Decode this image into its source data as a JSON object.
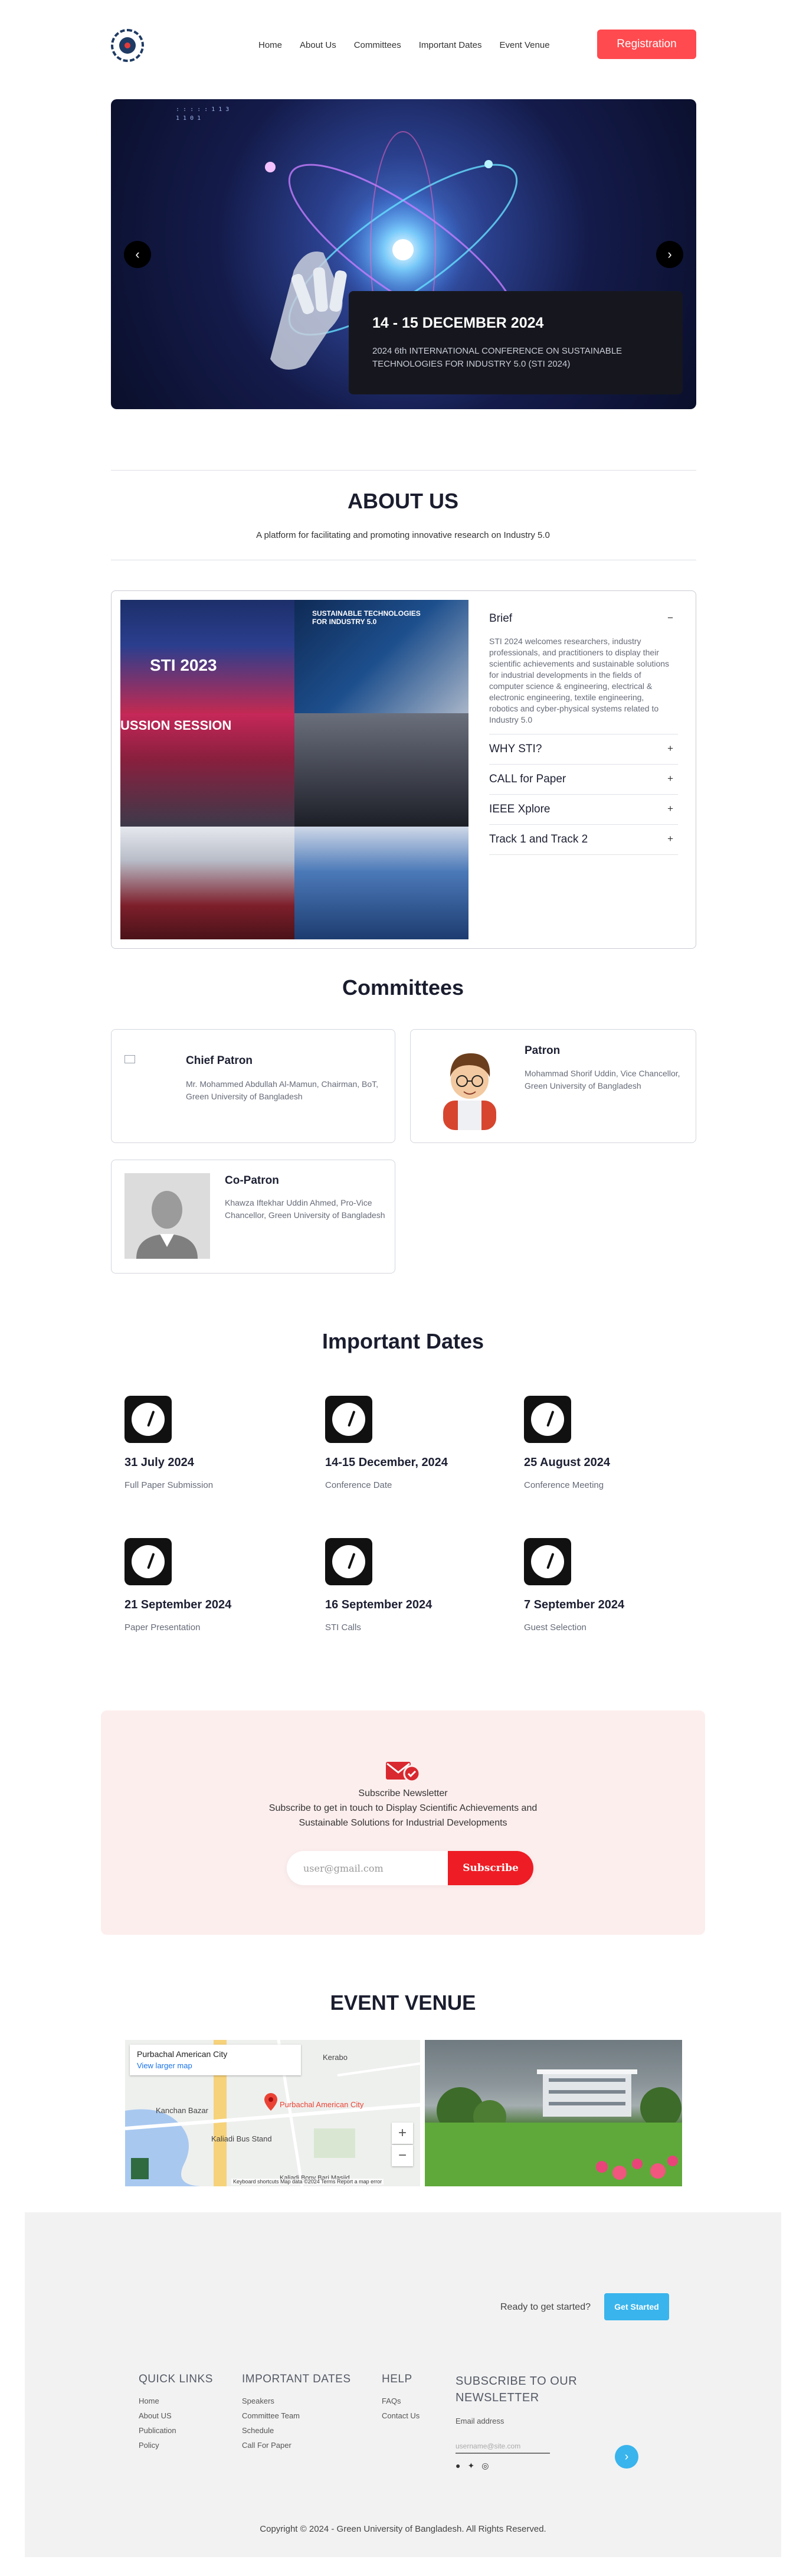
{
  "header": {
    "nav": [
      "Home",
      "About Us",
      "Committees",
      "Important Dates",
      "Event Venue"
    ],
    "register_label": "Registration"
  },
  "hero": {
    "date": "14 - 15 DECEMBER 2024",
    "description": "2024 6th INTERNATIONAL CONFERENCE ON SUSTAINABLE TECHNOLOGIES FOR INDUSTRY 5.0 (STI 2024)",
    "prev_icon": "chevron-left-icon",
    "next_icon": "chevron-right-icon"
  },
  "about": {
    "title": "ABOUT US",
    "subtitle": "A platform for facilitating and promoting innovative research on Industry 5.0",
    "collage_banner_1": "SUSTAINABLE TECHNOLOGIES FOR INDUSTRY 5.0",
    "collage_banner_2": "STI 2023",
    "collage_banner_3": "USSION SESSION",
    "accordion": [
      {
        "title": "Brief",
        "sign": "−",
        "body": "STI 2024 welcomes researchers, industry professionals, and practitioners to display their scientific achievements and sustainable solutions for industrial developments in the fields of computer science & engineering, electrical & electronic engineering, textile engineering, robotics and cyber-physical systems related to Industry 5.0"
      },
      {
        "title": "WHY STI?",
        "sign": "+"
      },
      {
        "title": "CALL for Paper",
        "sign": "+"
      },
      {
        "title": "IEEE Xplore",
        "sign": "+"
      },
      {
        "title": "Track 1 and Track 2",
        "sign": "+"
      }
    ]
  },
  "committees": {
    "title": "Committees",
    "members": [
      {
        "role": "Chief Patron",
        "person": "Mr. Mohammed Abdullah Al-Mamun, Chairman, BoT, Green University of Bangladesh"
      },
      {
        "role": "Patron",
        "person": "Mohammad Shorif Uddin, Vice Chancellor, Green University of Bangladesh"
      },
      {
        "role": "Co-Patron",
        "person": "Khawza Iftekhar Uddin Ahmed, Pro-Vice Chancellor, Green University of Bangladesh"
      }
    ]
  },
  "dates": {
    "title": "Important Dates",
    "items": [
      {
        "date": "31 July 2024",
        "label": "Full Paper Submission"
      },
      {
        "date": "14-15 December, 2024",
        "label": "Conference Date"
      },
      {
        "date": "25 August 2024",
        "label": "Conference Meeting"
      },
      {
        "date": "21 September 2024",
        "label": "Paper Presentation"
      },
      {
        "date": "16 September 2024",
        "label": "STI Calls"
      },
      {
        "date": "7 September 2024",
        "label": "Guest Selection"
      }
    ]
  },
  "newsletter": {
    "title": "Subscribe Newsletter",
    "subtitle": "Subscribe to get in touch to Display Scientific Achievements and Sustainable Solutions for Industrial Developments",
    "placeholder": "user@gmail.com",
    "button": "Subscribe"
  },
  "venue": {
    "title": "EVENT VENUE",
    "map_place": "Purbachal American City",
    "map_link": "View larger map",
    "map_labels": {
      "kerabo": "Kerabo",
      "bazar": "Kanchan Bazar",
      "pin": "Purbachal American City",
      "bus": "Kaliadi Bus Stand",
      "mosque": "Kaliadi Bony Bari Masjid"
    },
    "zoom_in": "+",
    "zoom_out": "−",
    "map_footer": "Keyboard shortcuts   Map data ©2024   Terms   Report a map error"
  },
  "footer": {
    "cta_text": "Ready to get started?",
    "cta_button": "Get Started",
    "quick_links": {
      "title": "QUICK LINKS",
      "links": [
        "Home",
        "About US",
        "Publication",
        "Policy"
      ]
    },
    "important_dates": {
      "title": "IMPORTANT DATES",
      "links": [
        "Speakers",
        "Committee Team",
        "Schedule",
        "Call For Paper"
      ]
    },
    "help": {
      "title": "HELP",
      "links": [
        "FAQs",
        "Contact Us"
      ]
    },
    "subscribe": {
      "title": "SUBSCRIBE TO OUR NEWSLETTER",
      "label": "Email address",
      "placeholder": "username@site.com"
    },
    "socials": [
      "facebook-icon",
      "twitter-icon",
      "instagram-icon"
    ],
    "copyright": "Copyright © 2024 - Green University of Bangladesh. All Rights Reserved."
  }
}
